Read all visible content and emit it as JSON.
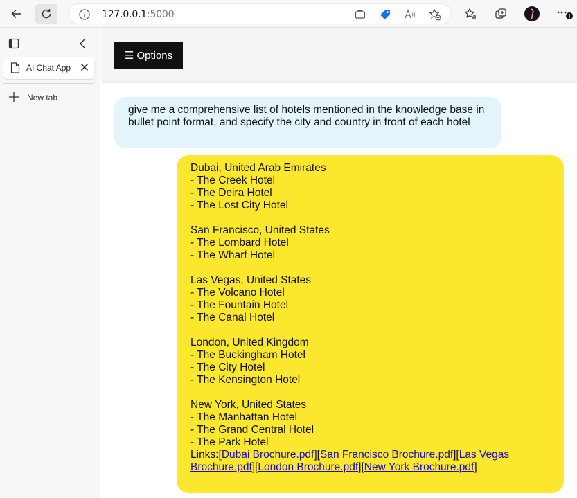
{
  "browser": {
    "address": {
      "host": "127.0.0.1",
      "port": ":5000"
    },
    "tabs": [
      {
        "label": "AI Chat App"
      }
    ],
    "new_tab_label": "New tab"
  },
  "app": {
    "options_label": "☰ Options",
    "user_message": "give me a comprehensive list of hotels mentioned in the knowledge base in bullet point format, and specify the city and country in front of each hotel",
    "bot_message": {
      "groups": [
        {
          "heading": "Dubai, United Arab Emirates",
          "items": [
            "- The Creek Hotel",
            "- The Deira Hotel",
            "- The Lost City Hotel"
          ]
        },
        {
          "heading": "San Francisco, United States",
          "items": [
            "- The Lombard Hotel",
            "- The Wharf Hotel"
          ]
        },
        {
          "heading": "Las Vegas, United States",
          "items": [
            "- The Volcano Hotel",
            "- The Fountain Hotel",
            "- The Canal Hotel"
          ]
        },
        {
          "heading": "London, United Kingdom",
          "items": [
            "- The Buckingham Hotel",
            "- The City Hotel",
            "- The Kensington Hotel"
          ]
        },
        {
          "heading": "New York, United States",
          "items": [
            "- The Manhattan Hotel",
            "- The Grand Central Hotel",
            "- The Park Hotel"
          ]
        }
      ],
      "links_prefix": "Links:",
      "links": [
        "Dubai Brochure.pdf",
        "San Francisco Brochure.pdf",
        "Las Vegas Brochure.pdf",
        "London Brochure.pdf",
        "New York Brochure.pdf"
      ]
    }
  },
  "colors": {
    "user_bubble": "#e3f5fb",
    "bot_bubble": "#fbe72e",
    "options_button": "#111111",
    "link": "#1a0dab"
  },
  "icons": [
    "back-arrow-icon",
    "refresh-icon",
    "info-icon",
    "app-available-icon",
    "shopping-tag-icon",
    "read-aloud-icon",
    "add-favorite-icon",
    "favorites-icon",
    "collections-icon",
    "profile-avatar-icon",
    "more-icon",
    "tab-actions-icon",
    "collapse-sidebar-icon",
    "document-icon",
    "close-icon",
    "plus-icon"
  ]
}
